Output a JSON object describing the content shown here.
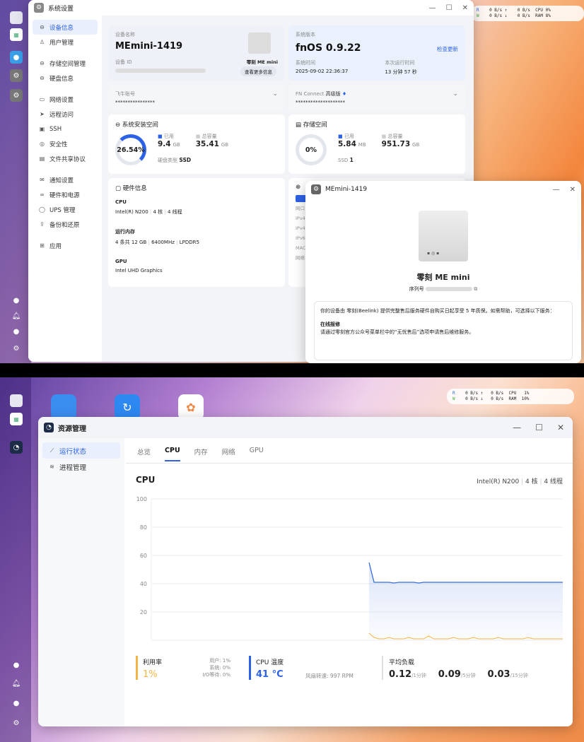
{
  "top": {
    "status": {
      "r": "R",
      "w": "W",
      "rv": "0 B/s",
      "wv": "0 B/s",
      "up": "0 B/s",
      "down": "0 B/s",
      "cpu_l": "CPU",
      "cpu_v": "0%",
      "ram_l": "RAM",
      "ram_v": "8%"
    },
    "window_title": "系统设置",
    "sidebar": [
      "设备信息",
      "用户管理",
      "存储空间管理",
      "硬盘信息",
      "网络设置",
      "远程访问",
      "SSH",
      "安全性",
      "文件共享协议",
      "通知设置",
      "硬件和电源",
      "UPS 管理",
      "备份和还原",
      "应用"
    ],
    "device": {
      "name_label": "设备名称",
      "name": "MEmini-1419",
      "id_label": "设备 ID",
      "model": "零刻 ME mini",
      "more": "查看更多信息"
    },
    "version": {
      "label": "系统版本",
      "value": "fnOS  0.9.22",
      "update": "检查更新",
      "time_label": "系统时间",
      "time": "2025-09-02 22:36:37",
      "uptime_label": "本次运行时间",
      "uptime": "13 分钟 57 秒"
    },
    "feiniu": {
      "label": "飞牛账号",
      "value": "****************"
    },
    "fnconnect": {
      "label": "FN Connect",
      "tier": "高级版",
      "value": "********************"
    },
    "sysdisk": {
      "title": "系统安装空间",
      "pct": "26.54%",
      "used_l": "已用",
      "used": "9.4",
      "used_u": "GB",
      "total_l": "总容量",
      "total": "35.41",
      "total_u": "GB",
      "type": "硬盘类型",
      "type_v": "SSD"
    },
    "storage": {
      "title": "存储空间",
      "pct": "0%",
      "used_l": "已用",
      "used": "5.84",
      "used_u": "MB",
      "total_l": "总容量",
      "total": "951.73",
      "total_u": "GB",
      "ssd": "SSD",
      "ssd_n": "1"
    },
    "hw": {
      "title": "硬件信息",
      "cpu_l": "CPU",
      "cpu": "Intel(R) N200",
      "cores": "4 核",
      "threads": "4 线程",
      "mem_l": "运行内存",
      "mem": "4 条共 12 GB",
      "freq": "6400MHz",
      "memtype": "LPDDR5",
      "gpu_l": "GPU",
      "gpu": "Intel UHD Graphics"
    },
    "net_rows": [
      "网口",
      "IPv4",
      "IPv4",
      "IPv6",
      "MAC",
      "网络"
    ],
    "popup": {
      "title": "MEmini-1419",
      "model": "零刻 ME mini",
      "serial_l": "序列号",
      "notice": "你的设备由 零刻(Beelink) 提供完整售后服务硬件自购买日起享受 5 年质保。如需帮助，可选择以下服务：",
      "repair_t": "在线报修",
      "repair": "请通过零刻官方公众号菜单栏中的“无忧售后”选项申请售后维修服务。"
    }
  },
  "bot": {
    "status": {
      "r": "R",
      "w": "W",
      "rv": "0 B/s",
      "wv": "0 B/s",
      "up": "0 B/s",
      "down": "0 B/s",
      "cpu_l": "CPU",
      "cpu_v": "1%",
      "ram_l": "RAM",
      "ram_v": "10%"
    },
    "window_title": "资源管理",
    "sidebar": [
      "运行状态",
      "进程管理"
    ],
    "tabs": [
      "总览",
      "CPU",
      "内存",
      "网络",
      "GPU"
    ],
    "cpu_title": "CPU",
    "cpu_model": "Intel(R) N200",
    "cores": "4 核",
    "threads": "4 线程",
    "util": {
      "label": "利用率",
      "value": "1%",
      "user_l": "用户:",
      "user": "1%",
      "sys_l": "系统:",
      "sys": "0%",
      "io_l": "I/O等待:",
      "io": "0%"
    },
    "temp": {
      "label": "CPU 温度",
      "value": "41 °C",
      "fan_l": "风扇转速:",
      "fan": "997 RPM"
    },
    "load": {
      "label": "平均负载",
      "v1": "0.12",
      "u1": "/1分钟",
      "v5": "0.09",
      "u5": "/5分钟",
      "v15": "0.03",
      "u15": "/15分钟"
    },
    "colors": {
      "line": "#3b6fd8",
      "util": "#f2b544"
    }
  },
  "chart_data": {
    "type": "line",
    "title": "CPU",
    "ylim": [
      0,
      100
    ],
    "yticks": [
      "100",
      "80",
      "60",
      "40",
      "20"
    ],
    "series": [
      {
        "values": [
          55,
          41,
          41,
          41,
          41,
          40.5,
          41,
          41,
          41,
          41,
          40.5,
          41,
          41,
          41,
          41,
          41,
          41,
          41,
          41,
          41,
          41,
          41,
          41,
          41,
          41,
          41,
          41,
          41,
          41,
          41,
          41,
          41,
          41,
          41,
          41,
          41,
          41,
          41,
          41,
          41
        ]
      },
      {
        "values": [
          5,
          2,
          1,
          1,
          2,
          1,
          1,
          1,
          2,
          1,
          1,
          1,
          3,
          1,
          1,
          1,
          1,
          2,
          1,
          1,
          1,
          2,
          1,
          1,
          1,
          1,
          2,
          1,
          1,
          1,
          1,
          1,
          2,
          1,
          1,
          1,
          1,
          1,
          1,
          1
        ]
      }
    ]
  }
}
